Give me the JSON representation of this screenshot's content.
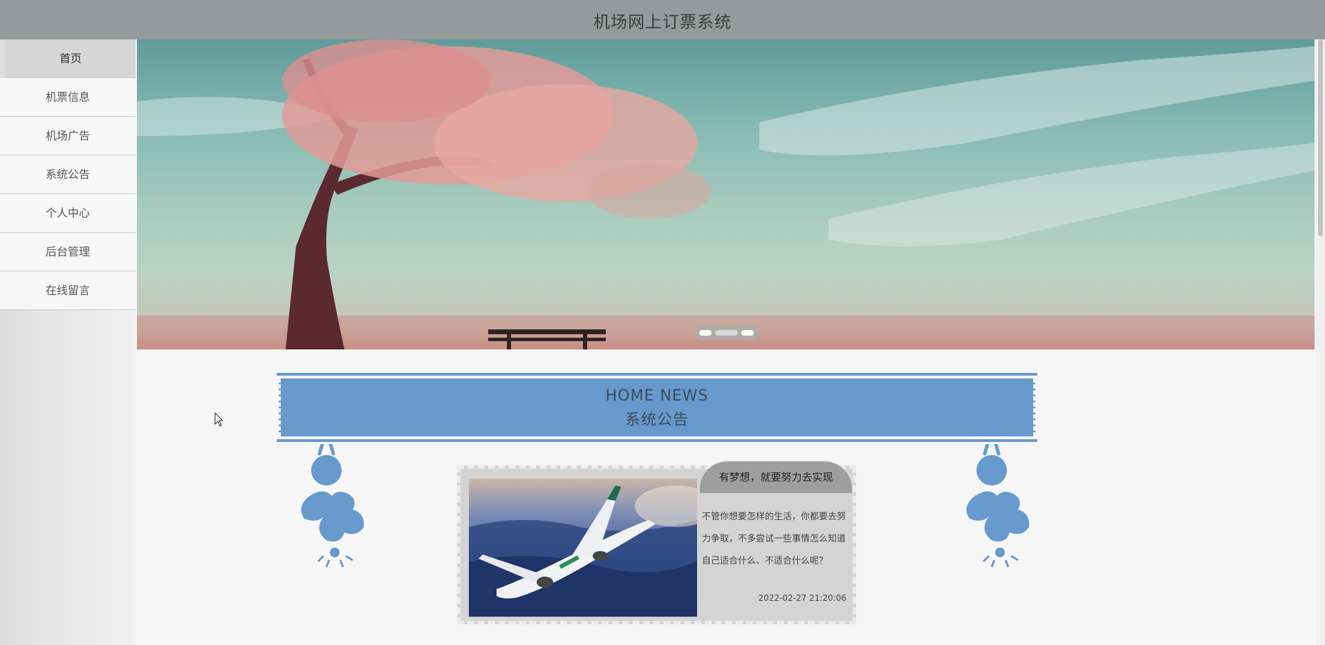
{
  "header": {
    "title": "机场网上订票系统"
  },
  "sidebar": {
    "items": [
      {
        "label": "首页",
        "active": true
      },
      {
        "label": "机票信息"
      },
      {
        "label": "机场广告"
      },
      {
        "label": "系统公告"
      },
      {
        "label": "个人中心"
      },
      {
        "label": "后台管理"
      },
      {
        "label": "在线留言"
      }
    ]
  },
  "banner": {
    "slide_count": 3,
    "active_slide": 2
  },
  "news": {
    "heading_en": "HOME NEWS",
    "heading_zh": "系统公告",
    "items": [
      {
        "title": "有梦想，就要努力去实现",
        "summary": "不管你想要怎样的生活，你都要去努力争取，不多尝试一些事情怎么知道自己适合什么、不适合什么呢？",
        "date": "2022-02-27 21:20:06"
      }
    ]
  },
  "colors": {
    "accent": "#6799cd",
    "topbar": "#959a9a"
  }
}
